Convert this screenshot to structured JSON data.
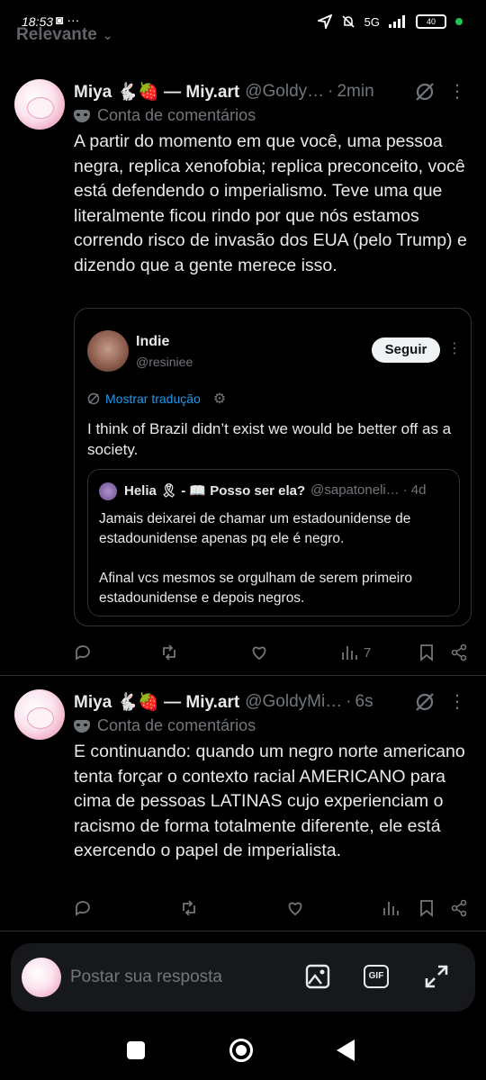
{
  "status_bar": {
    "time": "18:53",
    "left_icons": "◙ ···",
    "network": "5G",
    "battery": "40"
  },
  "sort": {
    "label": "Relevante"
  },
  "posts": [
    {
      "name": "Miya 🐇🍓 — Miy.art",
      "handle": "@Goldy…",
      "time": "2min",
      "label": "Conta de comentários",
      "text": "A partir do momento em que você, uma pessoa negra, replica xenofobia; replica preconceito, você está defendendo o imperialismo. Teve uma que literalmente ficou rindo por que nós estamos correndo risco de invasão dos EUA (pelo Trump) e dizendo que a gente merece isso.",
      "views": "7"
    },
    {
      "name": "Miya 🐇🍓 — Miy.art",
      "handle": "@GoldyMi…",
      "time": "6s",
      "label": "Conta de comentários",
      "text": "E continuando: quando um negro norte americano tenta forçar o contexto racial AMERICANO para cima de pessoas LATINAS cujo experienciam o racismo de forma totalmente diferente, ele está exercendo o papel de imperialista.",
      "views": ""
    }
  ],
  "embed": {
    "name": "Indie",
    "handle": "@resiniee",
    "follow_label": "Seguir",
    "translate_label": "Mostrar tradução",
    "text": "I think of Brazil didn’t exist we would be better off as a society.",
    "quote": {
      "name": "Helia 🎗 - 📖 Posso ser ela?",
      "handle": "@sapatoneli…",
      "time": "4d",
      "text": "Jamais deixarei de chamar um estadounidense de estadounidense apenas pq ele é negro.\n\nAfinal vcs mesmos se orgulham de serem primeiro estadounidense e depois negros."
    }
  },
  "composer": {
    "placeholder": "Postar sua resposta",
    "gif_label": "GIF"
  },
  "icons": [
    "reply-icon",
    "repost-icon",
    "like-icon",
    "views-icon",
    "bookmark-icon",
    "share-icon",
    "grok-icon",
    "more-icon",
    "image-icon",
    "expand-icon"
  ]
}
